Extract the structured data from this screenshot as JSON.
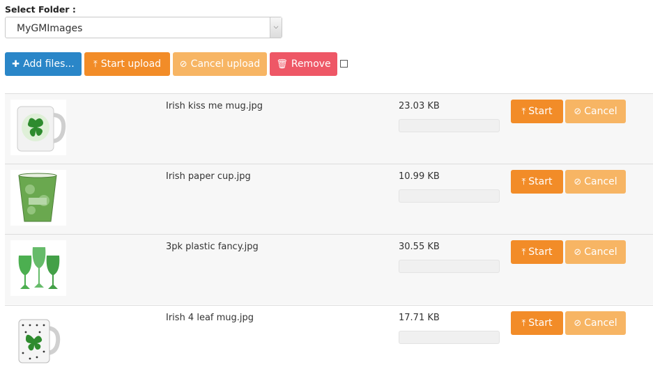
{
  "folder": {
    "label": "Select Folder :",
    "selected": "MyGMImages"
  },
  "toolbar": {
    "add_label": "Add files...",
    "start_label": "Start upload",
    "cancel_label": "Cancel upload",
    "remove_label": "Remove"
  },
  "icons": {
    "add": "plus-icon",
    "start": "circle-arrow-up-icon",
    "cancel": "ban-icon",
    "remove": "trash-icon"
  },
  "colors": {
    "primary": "#2a86c8",
    "warning": "#f28c28",
    "warning_light": "#f7b564",
    "danger": "#ee5766"
  },
  "files": [
    {
      "name": "Irish kiss me mug.jpg",
      "size": "23.03 KB",
      "progress": 0,
      "start_label": "Start",
      "cancel_label": "Cancel"
    },
    {
      "name": "Irish paper cup.jpg",
      "size": "10.99 KB",
      "progress": 0,
      "start_label": "Start",
      "cancel_label": "Cancel"
    },
    {
      "name": "3pk plastic fancy.jpg",
      "size": "30.55 KB",
      "progress": 0,
      "start_label": "Start",
      "cancel_label": "Cancel"
    },
    {
      "name": "Irish 4 leaf mug.jpg",
      "size": "17.71 KB",
      "progress": 0,
      "start_label": "Start",
      "cancel_label": "Cancel"
    }
  ]
}
